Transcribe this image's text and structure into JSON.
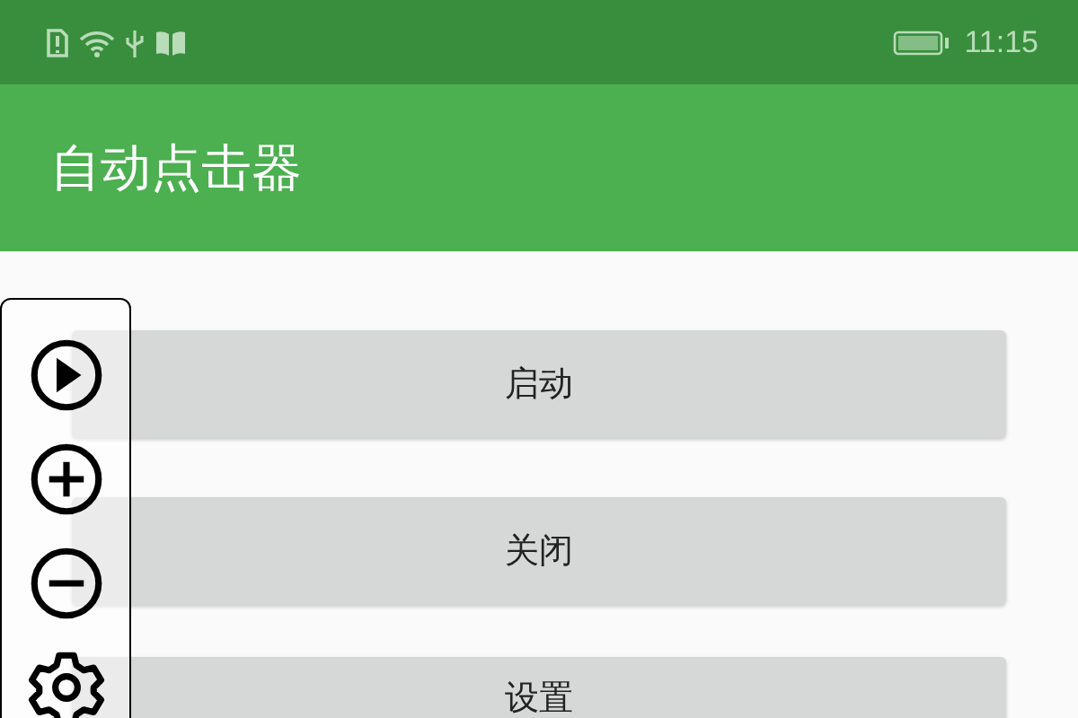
{
  "status_bar": {
    "time": "11:15"
  },
  "app_bar": {
    "title": "自动点击器"
  },
  "buttons": [
    {
      "label": "启动"
    },
    {
      "label": "关闭"
    },
    {
      "label": "设置"
    }
  ],
  "floating_toolbar": {
    "tools": [
      {
        "kind": "play"
      },
      {
        "kind": "add"
      },
      {
        "kind": "remove"
      },
      {
        "kind": "settings"
      }
    ]
  }
}
